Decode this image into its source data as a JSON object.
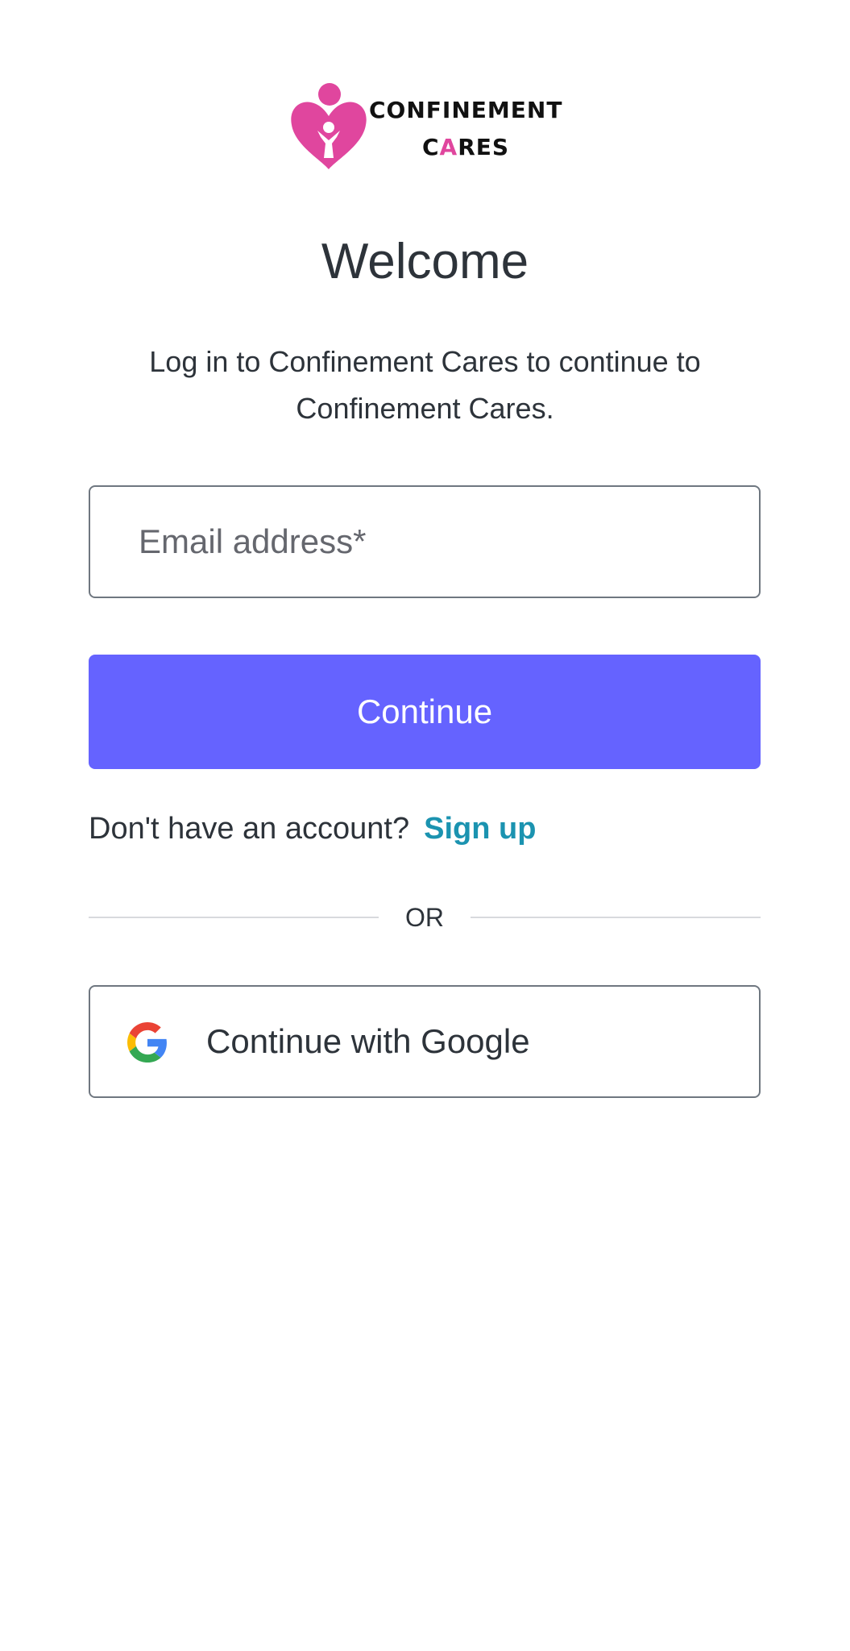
{
  "logo": {
    "line1": "CONFINEMENT",
    "line2_part1": "C",
    "line2_accent": "A",
    "line2_part2": "RES",
    "icon": "heart-person-icon",
    "brand_color": "#e0469e"
  },
  "title": "Welcome",
  "subtitle": "Log in to Confinement Cares to continue to Confinement Cares.",
  "email": {
    "placeholder": "Email address*",
    "value": ""
  },
  "continue_label": "Continue",
  "signup": {
    "prompt": "Don't have an account?",
    "link_label": "Sign up",
    "link_color": "#1b93b0"
  },
  "divider_text": "OR",
  "google": {
    "label": "Continue with Google",
    "icon": "google-icon"
  },
  "colors": {
    "primary_button": "#6563ff",
    "text": "#2d333a",
    "border": "#6f7780"
  }
}
